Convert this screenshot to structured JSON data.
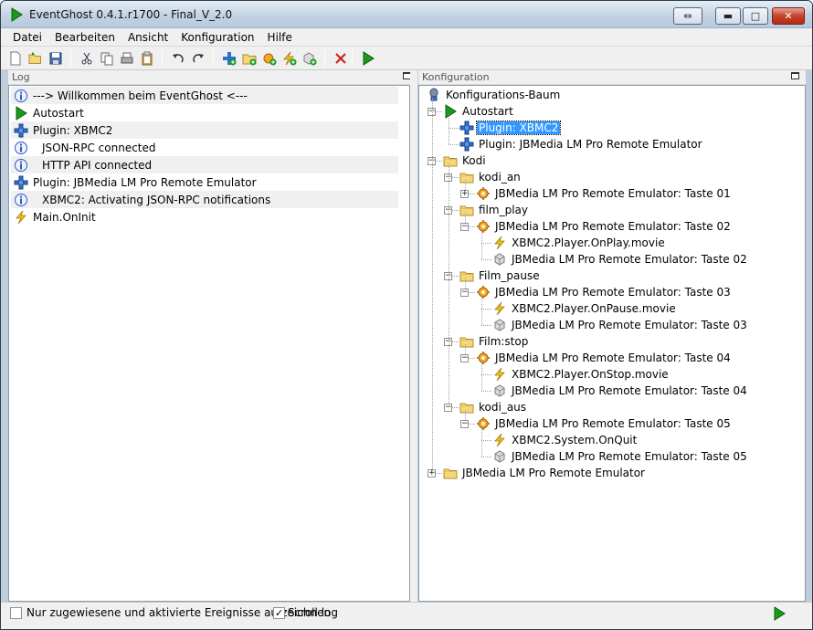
{
  "window": {
    "title": "EventGhost 0.4.1.r1700 - Final_V_2.0",
    "buttons": {
      "restore_label": "⇔",
      "minimize_label": "▬",
      "maximize_label": "□",
      "close_label": "✕"
    }
  },
  "menu": [
    "Datei",
    "Bearbeiten",
    "Ansicht",
    "Konfiguration",
    "Hilfe"
  ],
  "toolbar": [
    {
      "icon": "new-file-icon"
    },
    {
      "icon": "open-folder-icon"
    },
    {
      "icon": "save-icon"
    },
    {
      "icon": "cut-icon"
    },
    {
      "icon": "copy-icon"
    },
    {
      "icon": "print-icon"
    },
    {
      "icon": "paste-icon"
    },
    {
      "icon": "undo-icon"
    },
    {
      "icon": "redo-icon"
    },
    {
      "icon": "add-plugin-icon"
    },
    {
      "icon": "add-folder-icon"
    },
    {
      "icon": "add-macro-icon"
    },
    {
      "icon": "add-event-icon"
    },
    {
      "icon": "add-action-icon"
    },
    {
      "icon": "delete-icon"
    },
    {
      "icon": "execute-icon"
    }
  ],
  "log": {
    "header": "Log",
    "entries": [
      {
        "icon": "info-icon",
        "text": "---> Willkommen beim EventGhost <---",
        "indent": 0
      },
      {
        "icon": "play-icon",
        "text": "Autostart",
        "indent": 0
      },
      {
        "icon": "plugin-icon",
        "text": "Plugin: XBMC2",
        "indent": 0
      },
      {
        "icon": "info-icon",
        "text": "JSON-RPC connected",
        "indent": 1
      },
      {
        "icon": "info-icon",
        "text": "HTTP API connected",
        "indent": 1
      },
      {
        "icon": "plugin-icon",
        "text": "Plugin: JBMedia LM Pro Remote Emulator",
        "indent": 0
      },
      {
        "icon": "info-icon",
        "text": "XBMC2: Activating JSON-RPC notifications",
        "indent": 1
      },
      {
        "icon": "event-icon",
        "text": "Main.OnInit",
        "indent": 0
      }
    ]
  },
  "config": {
    "header": "Konfiguration",
    "tree": [
      {
        "icon": "tree-root-icon",
        "text": "Konfigurations-Baum",
        "level": 0,
        "expander": ""
      },
      {
        "icon": "play-icon",
        "text": "Autostart",
        "level": 1,
        "expander": "−"
      },
      {
        "icon": "plugin-icon",
        "text": "Plugin: XBMC2",
        "level": 2,
        "expander": "",
        "selected": true
      },
      {
        "icon": "plugin-icon",
        "text": "Plugin: JBMedia LM Pro Remote Emulator",
        "level": 2,
        "expander": ""
      },
      {
        "icon": "folder-icon",
        "text": "Kodi",
        "level": 1,
        "expander": "−"
      },
      {
        "icon": "folder-icon",
        "text": "kodi_an",
        "level": 2,
        "expander": "−"
      },
      {
        "icon": "macro-icon",
        "text": "JBMedia LM Pro Remote Emulator: Taste 01",
        "level": 3,
        "expander": "+"
      },
      {
        "icon": "folder-icon",
        "text": "film_play",
        "level": 2,
        "expander": "−"
      },
      {
        "icon": "macro-icon",
        "text": "JBMedia LM Pro Remote Emulator: Taste 02",
        "level": 3,
        "expander": "−"
      },
      {
        "icon": "event-icon",
        "text": "XBMC2.Player.OnPlay.movie",
        "level": 4,
        "expander": ""
      },
      {
        "icon": "action-icon",
        "text": "JBMedia LM Pro Remote Emulator: Taste 02",
        "level": 4,
        "expander": ""
      },
      {
        "icon": "folder-icon",
        "text": "Film_pause",
        "level": 2,
        "expander": "−"
      },
      {
        "icon": "macro-icon",
        "text": "JBMedia LM Pro Remote Emulator: Taste 03",
        "level": 3,
        "expander": "−"
      },
      {
        "icon": "event-icon",
        "text": "XBMC2.Player.OnPause.movie",
        "level": 4,
        "expander": ""
      },
      {
        "icon": "action-icon",
        "text": "JBMedia LM Pro Remote Emulator: Taste 03",
        "level": 4,
        "expander": ""
      },
      {
        "icon": "folder-icon",
        "text": "Film:stop",
        "level": 2,
        "expander": "−"
      },
      {
        "icon": "macro-icon",
        "text": "JBMedia LM Pro Remote Emulator: Taste 04",
        "level": 3,
        "expander": "−"
      },
      {
        "icon": "event-icon",
        "text": "XBMC2.Player.OnStop.movie",
        "level": 4,
        "expander": ""
      },
      {
        "icon": "action-icon",
        "text": "JBMedia LM Pro Remote Emulator: Taste 04",
        "level": 4,
        "expander": ""
      },
      {
        "icon": "folder-icon",
        "text": "kodi_aus",
        "level": 2,
        "expander": "−"
      },
      {
        "icon": "macro-icon",
        "text": "JBMedia LM Pro Remote Emulator: Taste 05",
        "level": 3,
        "expander": "−"
      },
      {
        "icon": "event-icon",
        "text": "XBMC2.System.OnQuit",
        "level": 4,
        "expander": ""
      },
      {
        "icon": "action-icon",
        "text": "JBMedia LM Pro Remote Emulator: Taste 05",
        "level": 4,
        "expander": ""
      },
      {
        "icon": "folder-icon",
        "text": "JBMedia LM Pro Remote Emulator",
        "level": 1,
        "expander": "+"
      }
    ]
  },
  "statusbar": {
    "only_assigned_label": "Nur zugewiesene und aktivierte Ereignisse aufzeichnen",
    "only_assigned_checked": false,
    "scroll_log_label": "Scroll log",
    "scroll_log_checked": true,
    "run_icon": "execute-icon"
  },
  "colors": {
    "selection": "#3399ff",
    "accent_green": "#1a9a1a",
    "event_yellow": "#f2c21a",
    "folder_yellow": "#f5d77a"
  }
}
